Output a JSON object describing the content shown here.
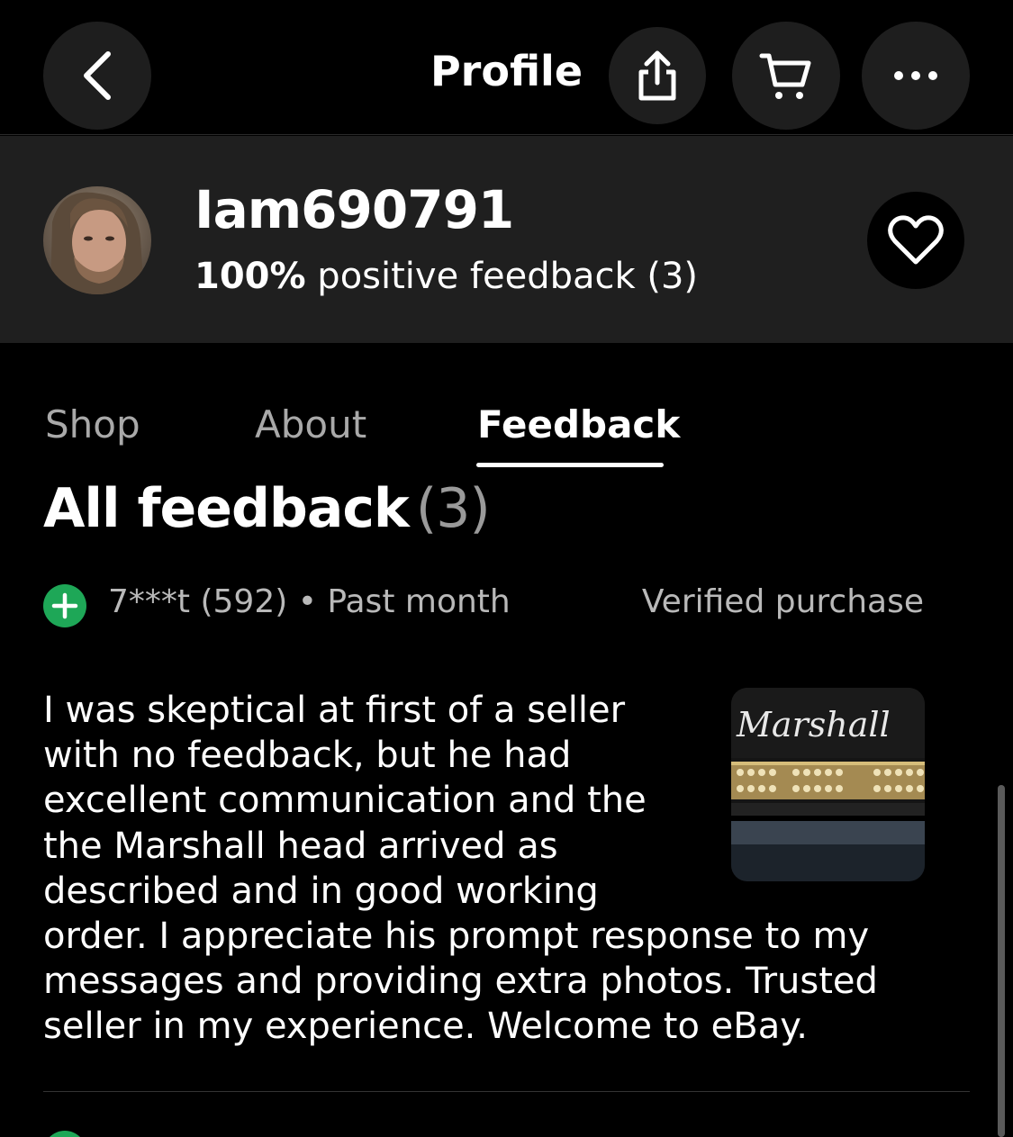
{
  "header": {
    "title": "Profile",
    "back_icon": "chevron-left-icon",
    "share_icon": "share-icon",
    "cart_icon": "cart-icon",
    "more_icon": "ellipsis-icon"
  },
  "seller": {
    "username": "Iam690791",
    "positive_percent": "100%",
    "feedback_text": "positive feedback (3)",
    "follow_icon": "heart-icon"
  },
  "tabs": [
    {
      "label": "Shop",
      "active": false
    },
    {
      "label": "About",
      "active": false
    },
    {
      "label": "Feedback",
      "active": true
    }
  ],
  "feedback": {
    "title": "All feedback",
    "count": "(3)",
    "items": [
      {
        "rating_icon": "plus-icon",
        "user": "7***t (592)",
        "separator": "•",
        "time": "Past month",
        "badge": "Verified purchase",
        "text": "I was skeptical at first of a seller with no feedback, but he had excellent communication and the the Marshall head arrived as described and in good working order.  I appreciate his prompt response to my messages and providing extra photos.  Trusted seller in my experience. Welcome to eBay.",
        "thumbnail_brand": "Marshall"
      }
    ]
  },
  "colors": {
    "background": "#000000",
    "profile_band": "#1f1f1f",
    "positive_green": "#1ea757",
    "muted_text": "#b9b9b9"
  }
}
